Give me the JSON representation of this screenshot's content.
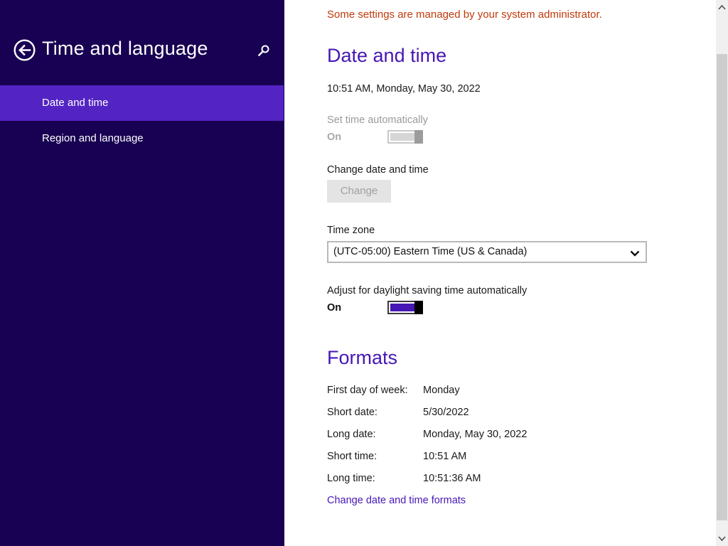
{
  "nav": {
    "title": "Time and language",
    "back_icon": "back-arrow-icon",
    "search_icon": "search-icon",
    "items": [
      {
        "label": "Date and time",
        "selected": true
      },
      {
        "label": "Region and language",
        "selected": false
      }
    ]
  },
  "notice": "Some settings are managed by your system administrator.",
  "date_time": {
    "title": "Date and time",
    "current": "10:51 AM, Monday, May 30, 2022",
    "set_auto": {
      "label": "Set time automatically",
      "state": "On",
      "enabled": false
    },
    "change": {
      "label": "Change date and time",
      "button": "Change",
      "enabled": false
    },
    "timezone": {
      "label": "Time zone",
      "value": "(UTC-05:00) Eastern Time (US & Canada)"
    },
    "dst": {
      "label": "Adjust for daylight saving time automatically",
      "state": "On",
      "enabled": true
    }
  },
  "formats": {
    "title": "Formats",
    "rows": [
      {
        "label": "First day of week:",
        "value": "Monday"
      },
      {
        "label": "Short date:",
        "value": "5/30/2022"
      },
      {
        "label": "Long date:",
        "value": "Monday, May 30, 2022"
      },
      {
        "label": "Short time:",
        "value": "10:51 AM"
      },
      {
        "label": "Long time:",
        "value": "10:51:36 AM"
      }
    ],
    "link": "Change date and time formats"
  },
  "colors": {
    "nav_background": "#180052",
    "nav_selected": "#5324c3",
    "accent": "#4617b4",
    "warning": "#c13a0a"
  }
}
